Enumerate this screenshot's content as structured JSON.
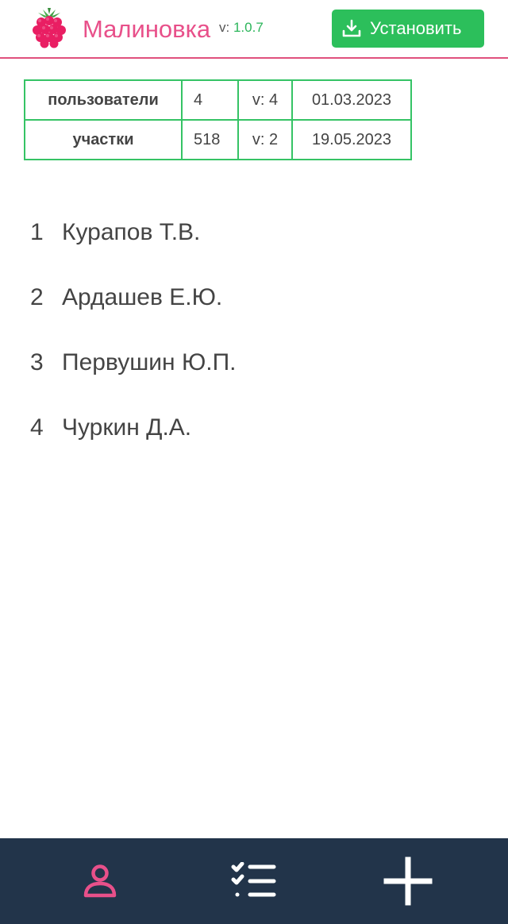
{
  "header": {
    "app_name": "Малиновка",
    "version_prefix": "v:",
    "version_number": "1.0.7",
    "install_label": "Установить",
    "logo_icon": "raspberry-icon",
    "install_icon": "download-icon"
  },
  "info_table": {
    "rows": [
      {
        "label": "пользователи",
        "count": "4",
        "version": "v: 4",
        "date": "01.03.2023"
      },
      {
        "label": "участки",
        "count": "518",
        "version": "v: 2",
        "date": "19.05.2023"
      }
    ]
  },
  "users": [
    {
      "num": "1",
      "name": "Курапов Т.В."
    },
    {
      "num": "2",
      "name": "Ардашев Е.Ю."
    },
    {
      "num": "3",
      "name": "Первушин Ю.П."
    },
    {
      "num": "4",
      "name": "Чуркин Д.А."
    }
  ],
  "bottom_nav": {
    "items": [
      {
        "icon": "user-icon",
        "active": true
      },
      {
        "icon": "checklist-icon",
        "active": false
      },
      {
        "icon": "plus-icon",
        "active": false
      }
    ]
  },
  "colors": {
    "accent_pink": "#e8508a",
    "accent_green": "#2cbf5b",
    "nav_bg": "#22344a"
  }
}
